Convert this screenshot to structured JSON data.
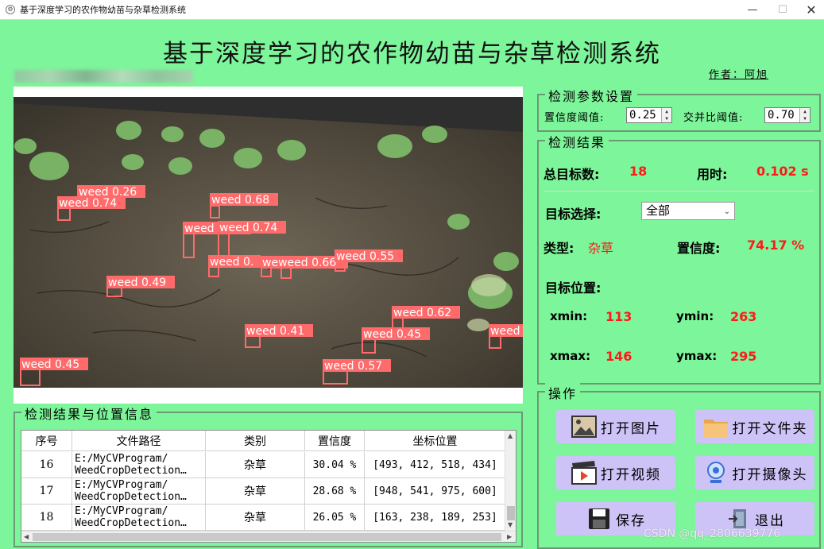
{
  "window": {
    "title": "基于深度学习的农作物幼苗与杂草检测系统",
    "min": "—",
    "max": "☐",
    "close": "✕"
  },
  "header": {
    "title": "基于深度学习的农作物幼苗与杂草检测系统",
    "author": "作者：阿旭"
  },
  "params": {
    "legend": "检测参数设置",
    "conf_label": "置信度阈值:",
    "conf_value": "0.25",
    "iou_label": "交并比阈值:",
    "iou_value": "0.70"
  },
  "results": {
    "legend": "检测结果",
    "total_label": "总目标数:",
    "total_value": "18",
    "time_label": "用时:",
    "time_value": "0.102 s",
    "select_label": "目标选择:",
    "select_value": "全部",
    "type_label": "类型:",
    "type_value": "杂草",
    "conf_label": "置信度:",
    "conf_value": "74.17 %",
    "pos_label": "目标位置:",
    "xmin_label": "xmin:",
    "xmin": "113",
    "ymin_label": "ymin:",
    "ymin": "263",
    "xmax_label": "xmax:",
    "xmax": "146",
    "ymax_label": "ymax:",
    "ymax": "295"
  },
  "ops": {
    "legend": "操作",
    "open_image": "打开图片",
    "open_folder": "打开文件夹",
    "open_video": "打开视频",
    "open_camera": "打开摄像头",
    "save": "保存",
    "exit": "退出"
  },
  "table": {
    "legend": "检测结果与位置信息",
    "headers": [
      "序号",
      "文件路径",
      "类别",
      "置信度",
      "坐标位置"
    ],
    "rows": [
      {
        "idx": "16",
        "path": "E:/MyCVProgram/\nWeedCropDetection…",
        "cls": "杂草",
        "conf": "30.04 %",
        "box": "[493, 412, 518, 434]"
      },
      {
        "idx": "17",
        "path": "E:/MyCVProgram/\nWeedCropDetection…",
        "cls": "杂草",
        "conf": "28.68 %",
        "box": "[948, 541, 975, 600]"
      },
      {
        "idx": "18",
        "path": "E:/MyCVProgram/\nWeedCropDetection…",
        "cls": "杂草",
        "conf": "26.05 %",
        "box": "[163, 238, 189, 253]"
      }
    ]
  },
  "detections": [
    "weed 0.26",
    "weed 0.74",
    "weed 0.68",
    "weed 0.74",
    "weed 0.74",
    "weed 0.",
    "weweed 0.66",
    "weed 0.55",
    "weed 0.49",
    "weed 0.62",
    "weed 0.41",
    "weed 0.45",
    "weed",
    "weed 0.45",
    "weed 0.57"
  ],
  "watermark": "CSDN @qq_2806639776",
  "colors": {
    "bg": "#7df59a",
    "button": "#cdc3f7",
    "accent": "#ff1a1a",
    "box": "#ff6b6b"
  }
}
